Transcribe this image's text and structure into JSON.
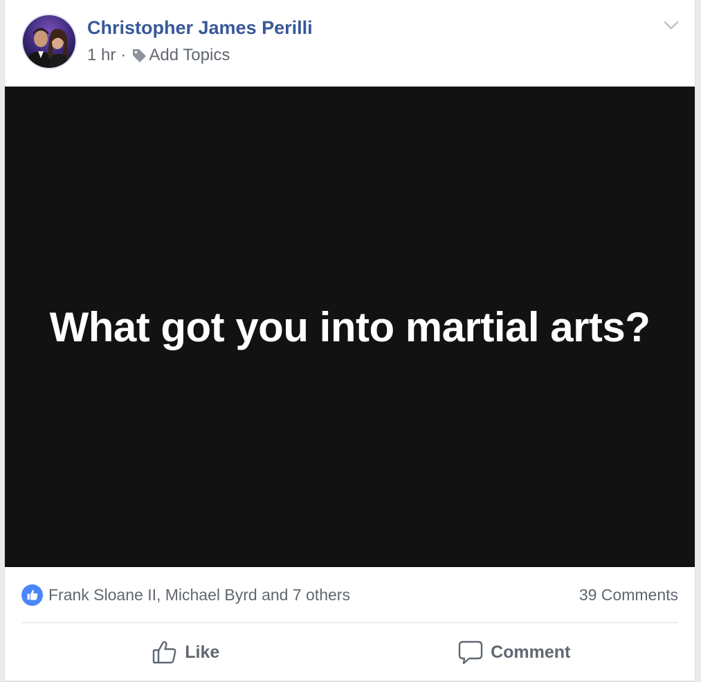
{
  "post": {
    "author": "Christopher James Perilli",
    "time": "1 hr",
    "separator": "·",
    "topics_label": "Add Topics",
    "text": "What got you into martial arts?",
    "background_color": "#121212"
  },
  "reactions": {
    "likers": "Frank Sloane II, Michael Byrd and 7 others",
    "comments_count": "39 Comments"
  },
  "actions": {
    "like_label": "Like",
    "comment_label": "Comment"
  },
  "icons": {
    "like_badge": "thumbs-up-icon",
    "tag": "tag-icon",
    "options": "chevron-down-icon",
    "like": "thumbs-up-outline-icon",
    "comment": "speech-bubble-icon"
  },
  "colors": {
    "author_link": "#385898",
    "like_badge": "#4a86f7",
    "secondary_text": "#606770"
  }
}
